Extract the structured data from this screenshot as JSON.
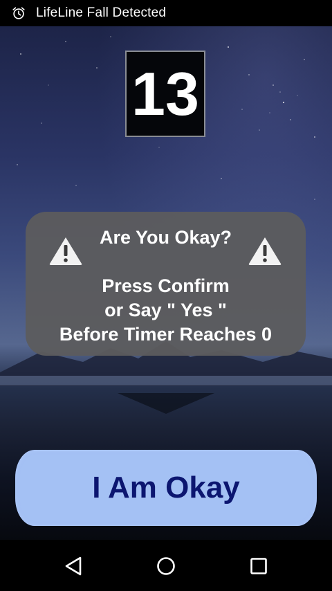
{
  "status_bar": {
    "icon": "alarm-clock-icon",
    "title": "LifeLine Fall Detected"
  },
  "timer": {
    "value": "13"
  },
  "alert": {
    "question": "Are You Okay?",
    "message_lines": [
      "Press Confirm",
      "or Say \" Yes \"",
      "Before Timer Reaches 0"
    ],
    "icon": "warning-icon"
  },
  "action": {
    "okay_label": "I Am Okay"
  },
  "nav_bar": {
    "back_icon": "back-triangle-icon",
    "home_icon": "home-circle-icon",
    "recent_icon": "recent-apps-square-icon"
  },
  "colors": {
    "button_bg": "#a4c1f4",
    "button_text": "#0c1670",
    "card_bg": "#5c5c5e"
  }
}
